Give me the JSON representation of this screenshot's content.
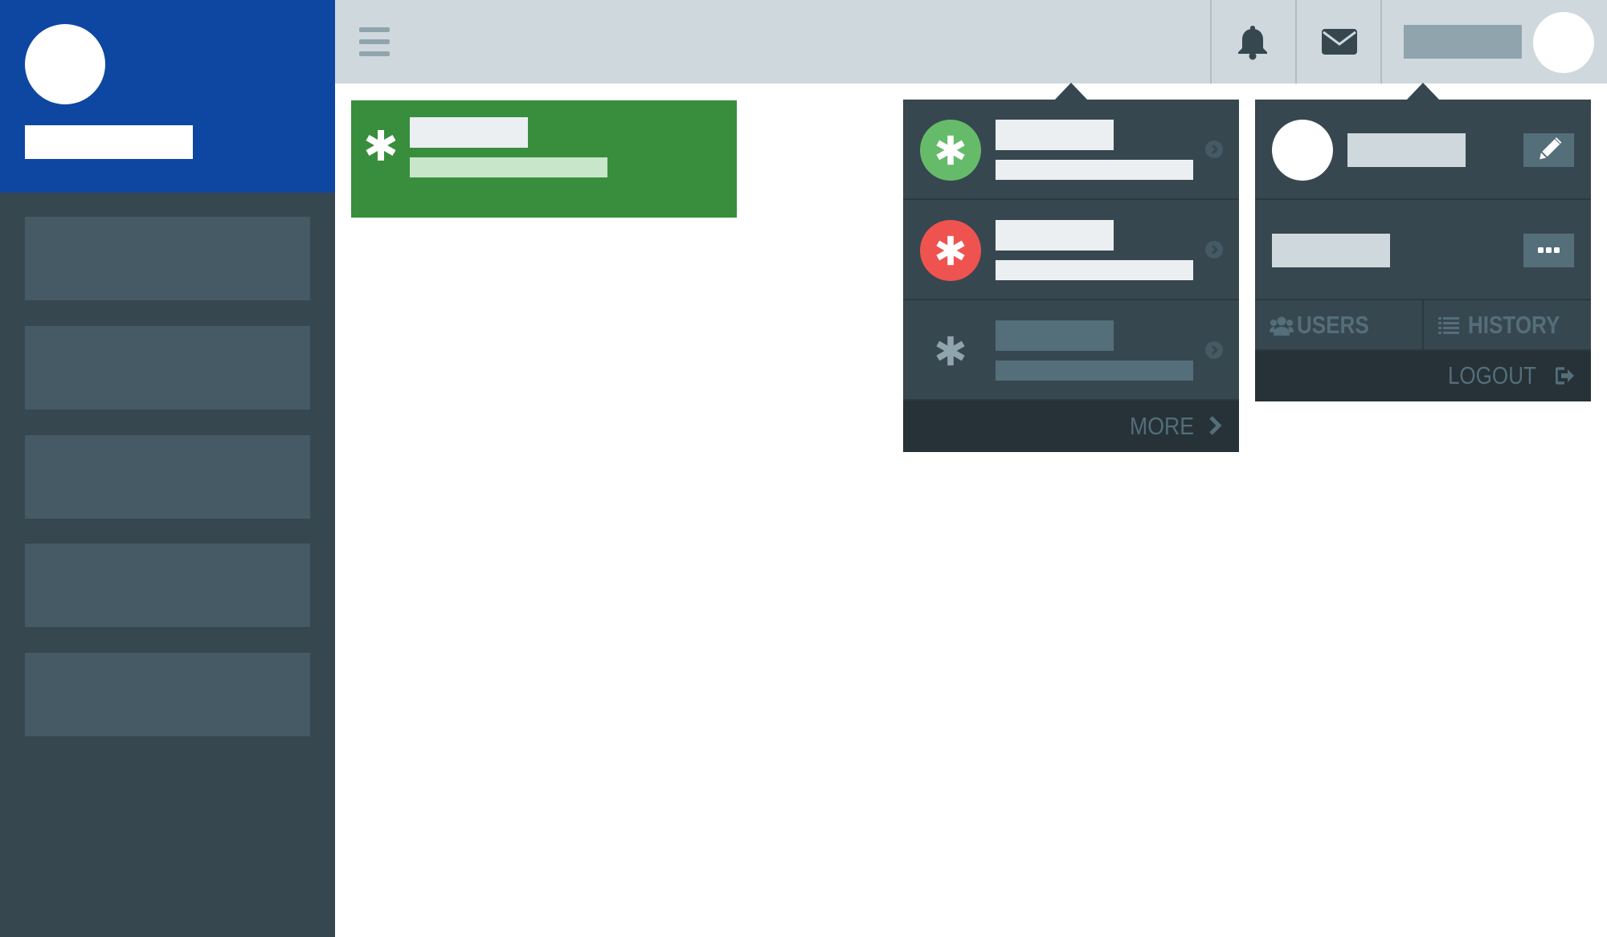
{
  "colors": {
    "sidebar_bg": "#37474f",
    "sidebar_header": "#0d47a1",
    "sidebar_item": "#455a64",
    "topbar_bg": "#cfd8dc",
    "alert_green": "#388e3c",
    "notif_success": "#66bb6a",
    "notif_error": "#ef5350",
    "panel_bg": "#37474f",
    "panel_footer": "#263238",
    "muted_text": "#546e7a"
  },
  "sidebar": {
    "items": [
      "item-1",
      "item-2",
      "item-3",
      "item-4",
      "item-5"
    ]
  },
  "topbar": {
    "icons": [
      "hamburger-icon",
      "bell-icon",
      "mail-icon"
    ]
  },
  "notifications": {
    "items": [
      {
        "status": "success",
        "icon": "asterisk-icon"
      },
      {
        "status": "error",
        "icon": "asterisk-icon"
      },
      {
        "status": "read",
        "icon": "asterisk-icon"
      }
    ],
    "more_label": "MORE"
  },
  "profile": {
    "tabs": [
      {
        "label": "USERS",
        "icon": "users-icon"
      },
      {
        "label": "HISTORY",
        "icon": "list-icon"
      }
    ],
    "logout_label": "LOGOUT"
  }
}
